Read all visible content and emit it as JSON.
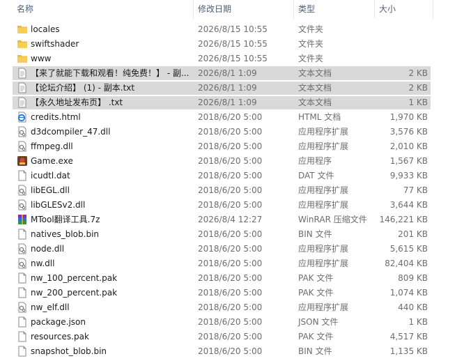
{
  "columns": {
    "name": "名称",
    "date": "修改日期",
    "type": "类型",
    "size": "大小"
  },
  "colors": {
    "header_text": "#4c607a",
    "selection_bg": "#d9d9d9",
    "folder": "#e8b73a"
  },
  "files": [
    {
      "name": "locales",
      "date": "2026/8/15 10:55",
      "type": "文件夹",
      "size": "",
      "icon": "folder-icon",
      "selected": false
    },
    {
      "name": "swiftshader",
      "date": "2026/8/15 10:55",
      "type": "文件夹",
      "size": "",
      "icon": "folder-icon",
      "selected": false
    },
    {
      "name": "www",
      "date": "2026/8/15 10:55",
      "type": "文件夹",
      "size": "",
      "icon": "folder-icon",
      "selected": false
    },
    {
      "name": "【来了就能下载和观看！纯免费！】 - 副...",
      "date": "2026/8/1 1:09",
      "type": "文本文档",
      "size": "2 KB",
      "icon": "text-file-icon",
      "selected": true
    },
    {
      "name": "【论坛介绍】 (1) - 副本.txt",
      "date": "2026/8/1 1:09",
      "type": "文本文档",
      "size": "2 KB",
      "icon": "text-file-icon",
      "selected": true
    },
    {
      "name": "【永久地址发布页】 .txt",
      "date": "2026/8/1 1:09",
      "type": "文本文档",
      "size": "1 KB",
      "icon": "text-file-icon",
      "selected": true
    },
    {
      "name": "credits.html",
      "date": "2018/6/20 5:00",
      "type": "HTML 文档",
      "size": "1,970 KB",
      "icon": "html-file-icon",
      "selected": false
    },
    {
      "name": "d3dcompiler_47.dll",
      "date": "2018/6/20 5:00",
      "type": "应用程序扩展",
      "size": "3,576 KB",
      "icon": "dll-file-icon",
      "selected": false
    },
    {
      "name": "ffmpeg.dll",
      "date": "2018/6/20 5:00",
      "type": "应用程序扩展",
      "size": "2,010 KB",
      "icon": "dll-file-icon",
      "selected": false
    },
    {
      "name": "Game.exe",
      "date": "2018/6/20 5:00",
      "type": "应用程序",
      "size": "1,567 KB",
      "icon": "exe-file-icon",
      "selected": false
    },
    {
      "name": "icudtl.dat",
      "date": "2018/6/20 5:00",
      "type": "DAT 文件",
      "size": "9,933 KB",
      "icon": "blank-file-icon",
      "selected": false
    },
    {
      "name": "libEGL.dll",
      "date": "2018/6/20 5:00",
      "type": "应用程序扩展",
      "size": "77 KB",
      "icon": "dll-file-icon",
      "selected": false
    },
    {
      "name": "libGLESv2.dll",
      "date": "2018/6/20 5:00",
      "type": "应用程序扩展",
      "size": "3,644 KB",
      "icon": "dll-file-icon",
      "selected": false
    },
    {
      "name": "MTool翻译工具.7z",
      "date": "2026/8/4 12:27",
      "type": "WinRAR 压缩文件",
      "size": "146,221 KB",
      "icon": "winrar-archive-icon",
      "selected": false
    },
    {
      "name": "natives_blob.bin",
      "date": "2018/6/20 5:00",
      "type": "BIN 文件",
      "size": "201 KB",
      "icon": "blank-file-icon",
      "selected": false
    },
    {
      "name": "node.dll",
      "date": "2018/6/20 5:00",
      "type": "应用程序扩展",
      "size": "5,615 KB",
      "icon": "dll-file-icon",
      "selected": false
    },
    {
      "name": "nw.dll",
      "date": "2018/6/20 5:00",
      "type": "应用程序扩展",
      "size": "82,404 KB",
      "icon": "dll-file-icon",
      "selected": false
    },
    {
      "name": "nw_100_percent.pak",
      "date": "2018/6/20 5:00",
      "type": "PAK 文件",
      "size": "809 KB",
      "icon": "blank-file-icon",
      "selected": false
    },
    {
      "name": "nw_200_percent.pak",
      "date": "2018/6/20 5:00",
      "type": "PAK 文件",
      "size": "1,074 KB",
      "icon": "blank-file-icon",
      "selected": false
    },
    {
      "name": "nw_elf.dll",
      "date": "2018/6/20 5:00",
      "type": "应用程序扩展",
      "size": "440 KB",
      "icon": "dll-file-icon",
      "selected": false
    },
    {
      "name": "package.json",
      "date": "2018/6/20 5:00",
      "type": "JSON 文件",
      "size": "1 KB",
      "icon": "blank-file-icon",
      "selected": false
    },
    {
      "name": "resources.pak",
      "date": "2018/6/20 5:00",
      "type": "PAK 文件",
      "size": "4,517 KB",
      "icon": "blank-file-icon",
      "selected": false
    },
    {
      "name": "snapshot_blob.bin",
      "date": "2018/6/20 5:00",
      "type": "BIN 文件",
      "size": "1,135 KB",
      "icon": "blank-file-icon",
      "selected": false
    }
  ]
}
